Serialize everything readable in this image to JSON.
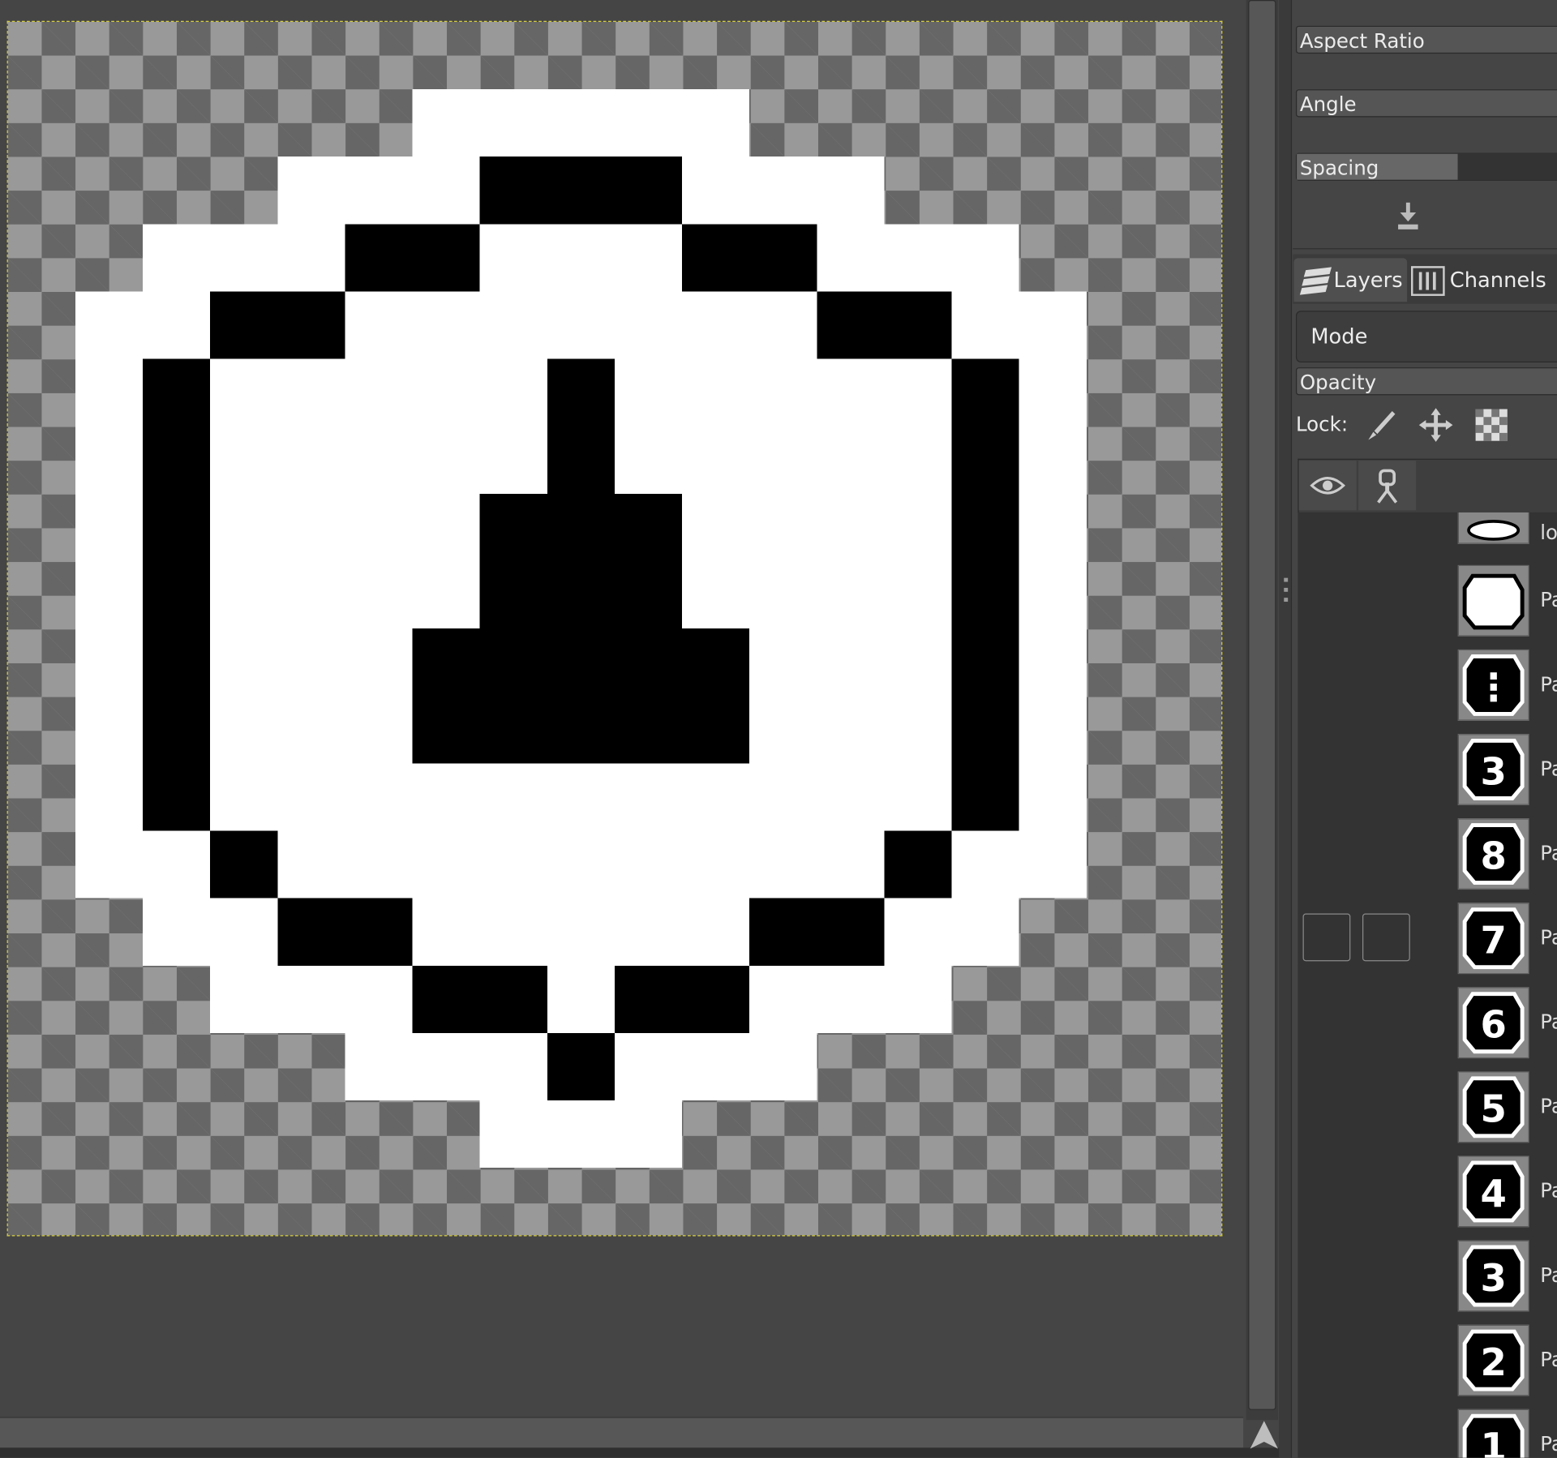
{
  "tool_options": {
    "aspect_ratio_label": "Aspect Ratio",
    "angle_label": "Angle",
    "spacing_label": "Spacing",
    "reset_icon": "download-reset-icon"
  },
  "dock_tabs": [
    {
      "label": "Layers",
      "icon": "layers-icon",
      "active": true
    },
    {
      "label": "Channels",
      "icon": "channels-icon",
      "active": false
    }
  ],
  "layers_panel": {
    "mode_label": "Mode",
    "opacity_label": "Opacity",
    "lock_label": "Lock:",
    "lock_icons": [
      "paintbrush-lock-icon",
      "move-lock-icon",
      "alpha-lock-icon"
    ],
    "header_icons": [
      "eye-icon",
      "chain-link-icon"
    ],
    "layers": [
      {
        "name": "lo",
        "glyph": ""
      },
      {
        "name": "Pa",
        "glyph": ""
      },
      {
        "name": "Pa",
        "glyph": "⋮"
      },
      {
        "name": "Pa",
        "glyph": "3"
      },
      {
        "name": "Pa",
        "glyph": "8"
      },
      {
        "name": "Pa",
        "glyph": "7"
      },
      {
        "name": "Pa",
        "glyph": "6"
      },
      {
        "name": "Pa",
        "glyph": "5"
      },
      {
        "name": "Pa",
        "glyph": "4"
      },
      {
        "name": "Pa",
        "glyph": "3"
      },
      {
        "name": "Pa",
        "glyph": "2"
      },
      {
        "name": "Pa",
        "glyph": "1"
      }
    ]
  },
  "colors": {
    "ui_background": "#454545",
    "canvas_boundary": "#d8d040",
    "art_black": "#000000",
    "art_white": "#ffffff"
  }
}
